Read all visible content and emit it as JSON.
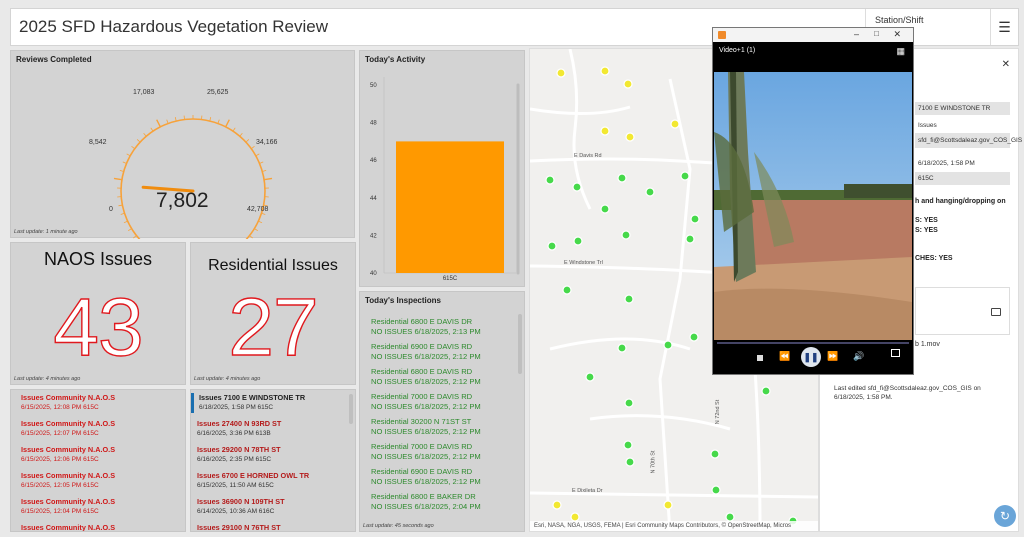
{
  "header": {
    "title": "2025 SFD Hazardous Vegetation Review",
    "station_label": "Station/Shift"
  },
  "reviews": {
    "title": "Reviews Completed",
    "value": "7,802",
    "ticks": [
      "0",
      "8,542",
      "17,083",
      "25,625",
      "34,166",
      "42,708"
    ],
    "last_update": "Last update: 1 minute ago",
    "gauge_fraction": 0.1827
  },
  "activity": {
    "title": "Today's Activity",
    "y_ticks": [
      "50",
      "48",
      "46",
      "44",
      "42",
      "40"
    ],
    "bar_label": "615C"
  },
  "chart_data": {
    "type": "bar",
    "categories": [
      "615C"
    ],
    "values": [
      47
    ],
    "ylim": [
      40,
      50
    ],
    "title": "Today's Activity",
    "colors": [
      "#ff9900"
    ]
  },
  "naos": {
    "title": "NAOS Issues",
    "count": "43",
    "last_update": "Last update: 4 minutes ago"
  },
  "residential": {
    "title": "Residential Issues",
    "count": "27",
    "last_update": "Last update: 4 minutes ago"
  },
  "naos_list": [
    {
      "title": "Issues  Community N.A.O.S",
      "detail": "6/15/2025, 12:08 PM  615C"
    },
    {
      "title": "Issues  Community N.A.O.S",
      "detail": "6/15/2025, 12:07 PM  615C"
    },
    {
      "title": "Issues  Community N.A.O.S",
      "detail": "6/15/2025, 12:06 PM  615C"
    },
    {
      "title": "Issues  Community N.A.O.S",
      "detail": "6/15/2025, 12:05 PM  615C"
    },
    {
      "title": "Issues  Community N.A.O.S",
      "detail": "6/15/2025, 12:04 PM  615C"
    },
    {
      "title": "Issues  Community N.A.O.S",
      "detail": ""
    }
  ],
  "res_list": [
    {
      "title": "Issues  7100 E WINDSTONE TR",
      "detail": "6/18/2025, 1:58 PM  615C"
    },
    {
      "title": "Issues  27400  N 93RD ST",
      "detail": "6/16/2025, 3:36 PM  613B"
    },
    {
      "title": "Issues  29200  N 78TH ST",
      "detail": "6/16/2025, 2:35 PM  615C"
    },
    {
      "title": "Issues  6700  E HORNED OWL TR",
      "detail": "6/15/2025, 11:50 AM  615C"
    },
    {
      "title": "Issues  36900  N 109TH ST",
      "detail": "6/14/2025, 10:36 AM  616C"
    },
    {
      "title": "Issues  29100  N 76TH ST",
      "detail": ""
    }
  ],
  "inspections": {
    "title": "Today's Inspections",
    "last_update": "Last update: 45 seconds ago",
    "items": [
      {
        "line1": "Residential   6800  E DAVIS DR",
        "line2": "NO ISSUES  6/18/2025, 2:13 PM"
      },
      {
        "line1": "Residential   6900  E DAVIS RD",
        "line2": "NO ISSUES  6/18/2025, 2:12 PM"
      },
      {
        "line1": "Residential   6800  E DAVIS RD",
        "line2": "NO ISSUES  6/18/2025, 2:12 PM"
      },
      {
        "line1": "Residential   7000  E DAVIS RD",
        "line2": "NO ISSUES  6/18/2025, 2:12 PM"
      },
      {
        "line1": "Residential   30200  N 71ST ST",
        "line2": "NO ISSUES  6/18/2025, 2:12 PM"
      },
      {
        "line1": "Residential   7000  E DAVIS RD",
        "line2": "NO ISSUES  6/18/2025, 2:12 PM"
      },
      {
        "line1": "Residential   6900  E DAVIS RD",
        "line2": "NO ISSUES  6/18/2025, 2:12 PM"
      },
      {
        "line1": "Residential   6800  E BAKER DR",
        "line2": "NO ISSUES  6/18/2025, 2:04 PM"
      }
    ]
  },
  "map": {
    "attribution": "Esri, NASA, NGA, USGS, FEMA | Esri Community Maps Contributors, © OpenStreetMap, Micros",
    "streets": [
      "E Davis Rd",
      "E Windstone Trl",
      "E Dixileta Dr",
      "N 70th St",
      "N 72nd St"
    ]
  },
  "side_panel": {
    "rows": [
      "7100 E WINDSTONE TR",
      "Issues",
      "sfd_fi@Scottsdaleaz.gov_COS_GIS",
      "6/18/2025, 1:58 PM",
      "615C"
    ],
    "question": "h and hanging/dropping on",
    "answers": [
      "S: YES",
      "S: YES",
      "CHES: YES"
    ],
    "attachment": "b 1.mov",
    "last_edited": "Last edited  sfd_fi@Scottsdaleaz.gov_COS_GIS on 6/18/2025, 1:58 PM."
  },
  "video": {
    "title": "Video+1 (1)"
  }
}
